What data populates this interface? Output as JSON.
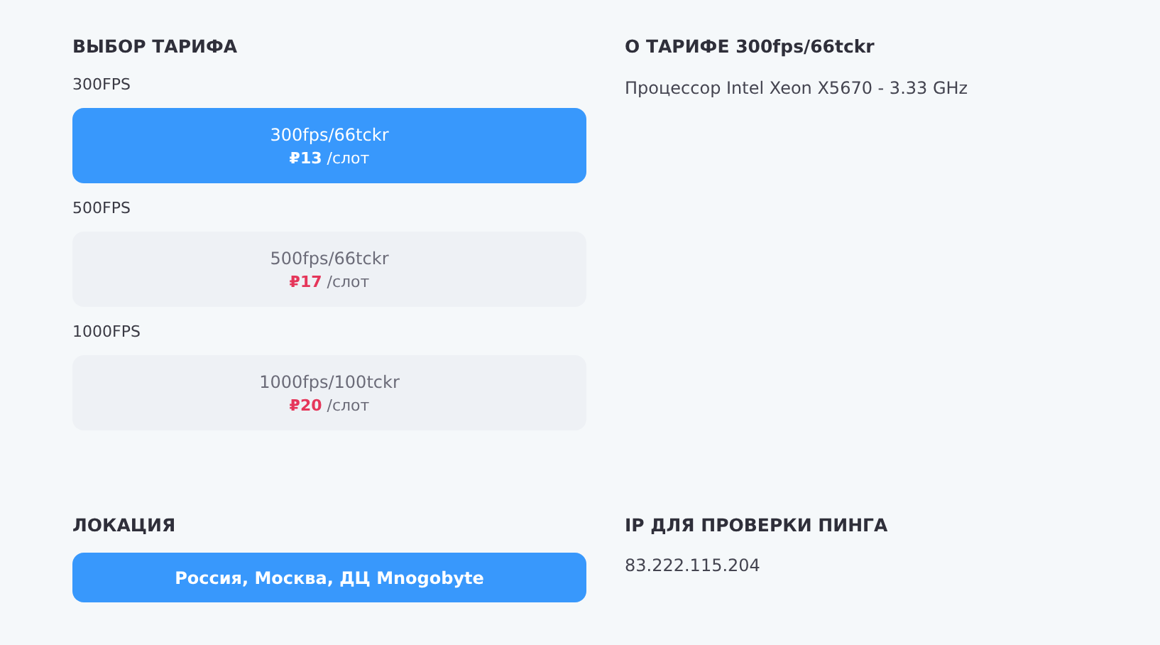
{
  "tariff_section": {
    "title": "ВЫБОР ТАРИФА",
    "groups": [
      {
        "label": "300FPS",
        "name": "300fps/66tckr",
        "price": "₽13",
        "unit": "/слот",
        "selected": true
      },
      {
        "label": "500FPS",
        "name": "500fps/66tckr",
        "price": "₽17",
        "unit": "/слот",
        "selected": false
      },
      {
        "label": "1000FPS",
        "name": "1000fps/100tckr",
        "price": "₽20",
        "unit": "/слот",
        "selected": false
      }
    ]
  },
  "about": {
    "title": "О ТАРИФЕ 300fps/66tckr",
    "text": "Процессор Intel Xeon X5670 - 3.33 GHz"
  },
  "location": {
    "title": "ЛОКАЦИЯ",
    "value": "Россия, Москва, ДЦ Mnogobyte",
    "selected": true
  },
  "ping": {
    "title": "IP ДЛЯ ПРОВЕРКИ ПИНГА",
    "ip": "83.222.115.204"
  }
}
